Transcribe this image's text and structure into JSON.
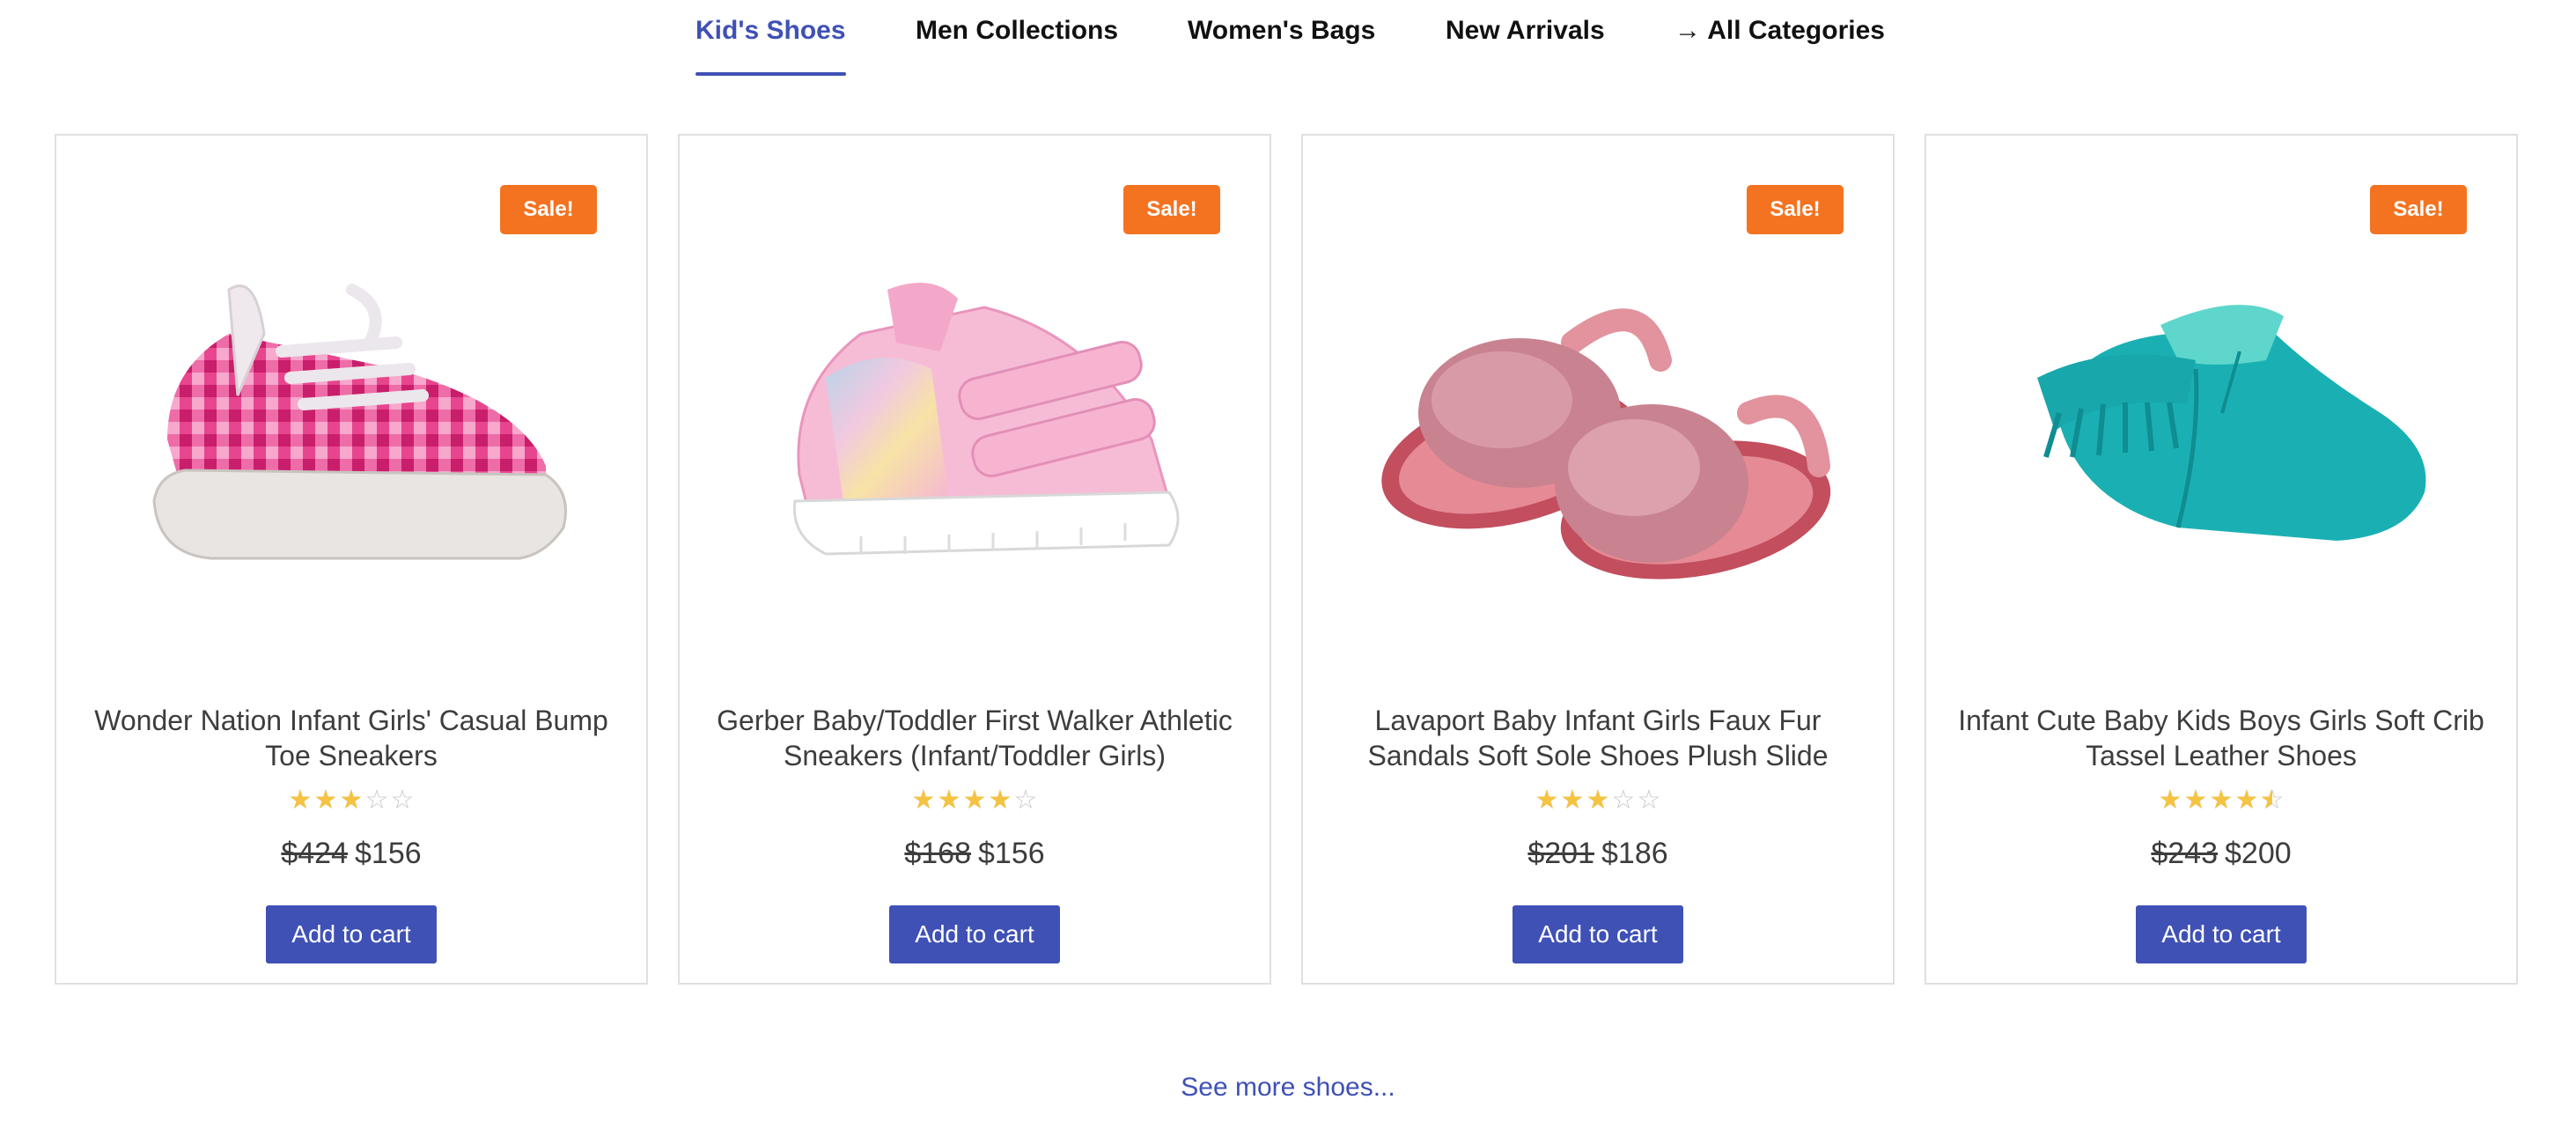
{
  "tabs": [
    {
      "label": "Kid's Shoes",
      "active": true
    },
    {
      "label": "Men Collections",
      "active": false
    },
    {
      "label": "Women's Bags",
      "active": false
    },
    {
      "label": "New Arrivals",
      "active": false
    },
    {
      "label": "→ All Categories",
      "active": false
    }
  ],
  "products": [
    {
      "badge": "Sale!",
      "title": "Wonder Nation Infant Girls' Casual Bump Toe Sneakers",
      "rating": 3,
      "old_price": "$424",
      "price": "$156",
      "button": "Add to cart",
      "image_icon": "pink-gingham-sneaker-image"
    },
    {
      "badge": "Sale!",
      "title": "Gerber Baby/Toddler First Walker Athletic Sneakers (Infant/Toddler Girls)",
      "rating": 4,
      "old_price": "$168",
      "price": "$156",
      "button": "Add to cart",
      "image_icon": "pink-glitter-sneaker-image"
    },
    {
      "badge": "Sale!",
      "title": "Lavaport Baby Infant Girls Faux Fur Sandals Soft Sole Shoes Plush Slide",
      "rating": 3,
      "old_price": "$201",
      "price": "$186",
      "button": "Add to cart",
      "image_icon": "pink-fur-sandals-image"
    },
    {
      "badge": "Sale!",
      "title": "Infant Cute Baby Kids Boys Girls Soft Crib Tassel Leather Shoes",
      "rating": 4.5,
      "old_price": "$243",
      "price": "$200",
      "button": "Add to cart",
      "image_icon": "teal-moccasin-image"
    }
  ],
  "see_more": "See more shoes...",
  "colors": {
    "accent": "#3f51b5",
    "sale": "#f47321",
    "star": "#f5c342"
  }
}
